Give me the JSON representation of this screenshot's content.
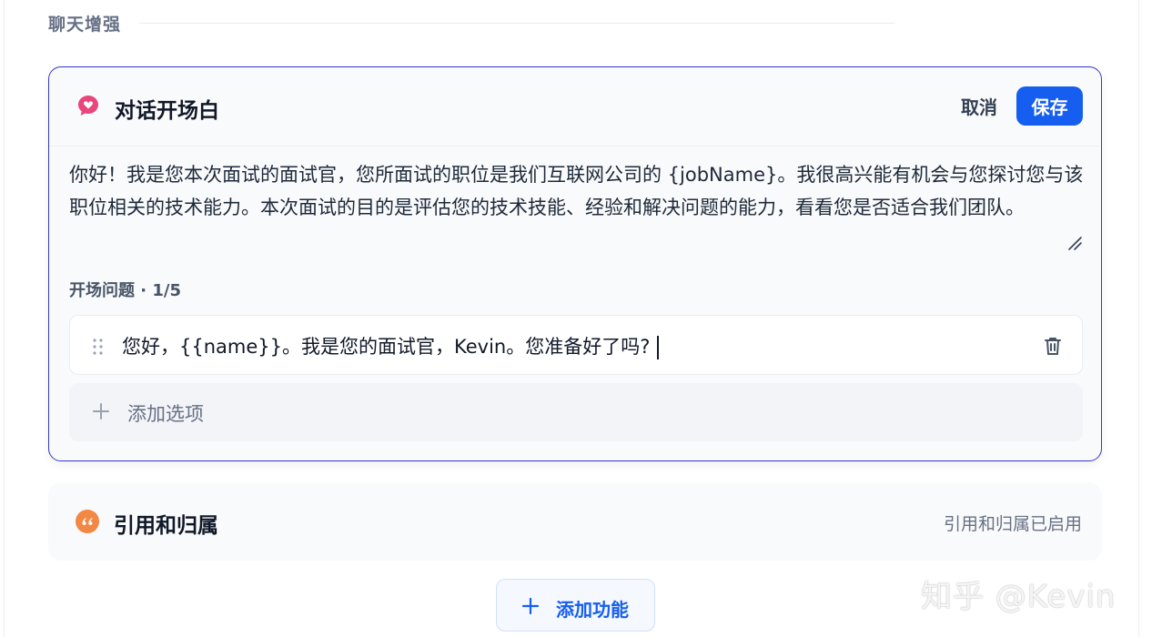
{
  "section": {
    "title": "聊天增强"
  },
  "opener": {
    "title": "对话开场白",
    "cancel_label": "取消",
    "save_label": "保存",
    "intro_text": "你好！我是您本次面试的面试官，您所面试的职位是我们互联网公司的 {jobName}。我很高兴能有机会与您探讨您与该职位相关的技术能力。本次面试的目的是评估您的技术技能、经验和解决问题的能力，看看您是否适合我们团队。",
    "questions_label": "开场问题 · 1/5",
    "questions": [
      {
        "text": "您好，{{name}}。我是您的面试官，Kevin。您准备好了吗?"
      }
    ],
    "add_option_label": "添加选项",
    "icon": "chat-bubble-heart-icon",
    "accent_color": "#e8467c"
  },
  "citation": {
    "title": "引用和归属",
    "status": "引用和归属已启用",
    "icon": "quote-icon",
    "accent_color": "#f38744"
  },
  "add_feature": {
    "label": "添加功能"
  },
  "watermark": {
    "text": "知乎 @Kevin"
  },
  "colors": {
    "primary": "#155eef",
    "card_border_active": "#3538cd"
  }
}
